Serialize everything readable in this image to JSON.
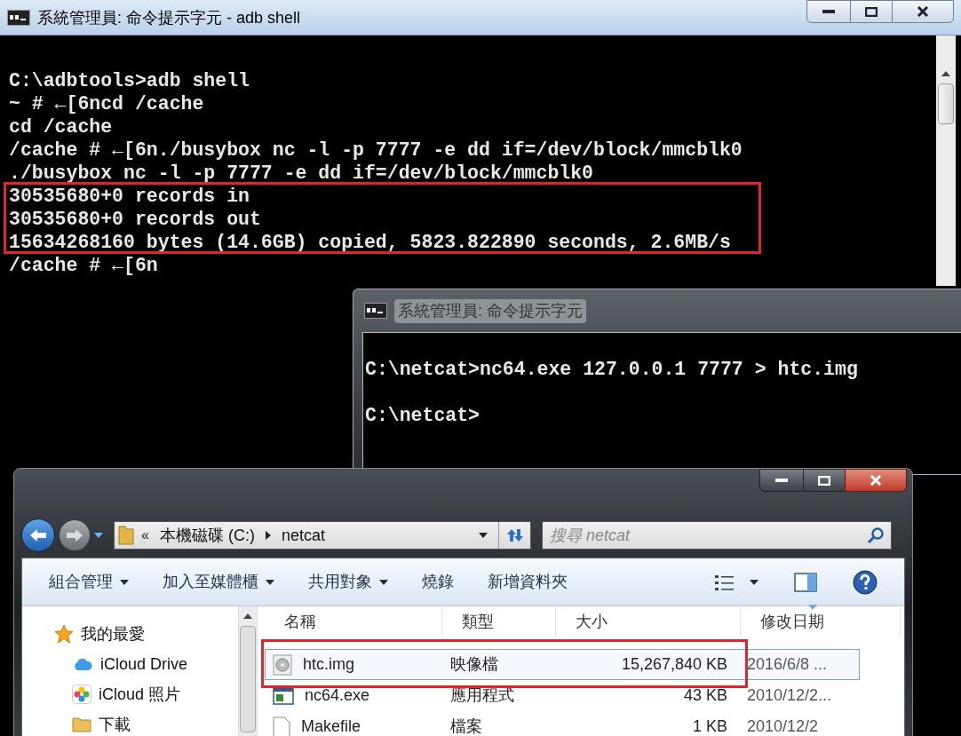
{
  "console_window": {
    "title": "系統管理員: 命令提示字元 - adb shell",
    "lines": [
      "C:\\adbtools>adb shell",
      "~ # ←[6ncd /cache",
      "cd /cache",
      "/cache # ←[6n./busybox nc -l -p 7777 -e dd if=/dev/block/mmcblk0",
      "./busybox nc -l -p 7777 -e dd if=/dev/block/mmcblk0",
      "30535680+0 records in",
      "30535680+0 records out",
      "15634268160 bytes (14.6GB) copied, 5823.822890 seconds, 2.6MB/s",
      "/cache # ←[6n"
    ]
  },
  "netcat_window": {
    "title": "系統管理員: 命令提示字元",
    "lines": [
      "C:\\netcat>nc64.exe 127.0.0.1 7777 > htc.img",
      "C:\\netcat>"
    ]
  },
  "explorer": {
    "address": {
      "overflow": "«",
      "crumbs": [
        "本機磁碟 (C:)",
        "netcat"
      ]
    },
    "search": {
      "placeholder": "搜尋 netcat"
    },
    "toolbar": [
      {
        "label": "組合管理",
        "dropdown": true
      },
      {
        "label": "加入至媒體櫃",
        "dropdown": true
      },
      {
        "label": "共用對象",
        "dropdown": true
      },
      {
        "label": "燒錄",
        "dropdown": false
      },
      {
        "label": "新增資料夾",
        "dropdown": false
      }
    ],
    "nav": [
      {
        "label": "我的最愛",
        "kind": "favorites"
      },
      {
        "label": "iCloud Drive",
        "kind": "cloud"
      },
      {
        "label": "iCloud 照片",
        "kind": "photos"
      },
      {
        "label": "下載",
        "kind": "folder"
      }
    ],
    "columns": [
      "名稱",
      "類型",
      "大小",
      "修改日期"
    ],
    "rows": [
      {
        "name": "htc.img",
        "type": "映像檔",
        "size": "15,267,840 KB",
        "modified": "2016/6/8 ...",
        "kind": "image",
        "selected": true
      },
      {
        "name": "nc64.exe",
        "type": "應用程式",
        "size": "43 KB",
        "modified": "2010/12/2...",
        "kind": "program",
        "selected": false
      },
      {
        "name": "Makefile",
        "type": "檔案",
        "size": "1 KB",
        "modified": "2010/12/2",
        "kind": "file",
        "selected": false
      }
    ]
  }
}
